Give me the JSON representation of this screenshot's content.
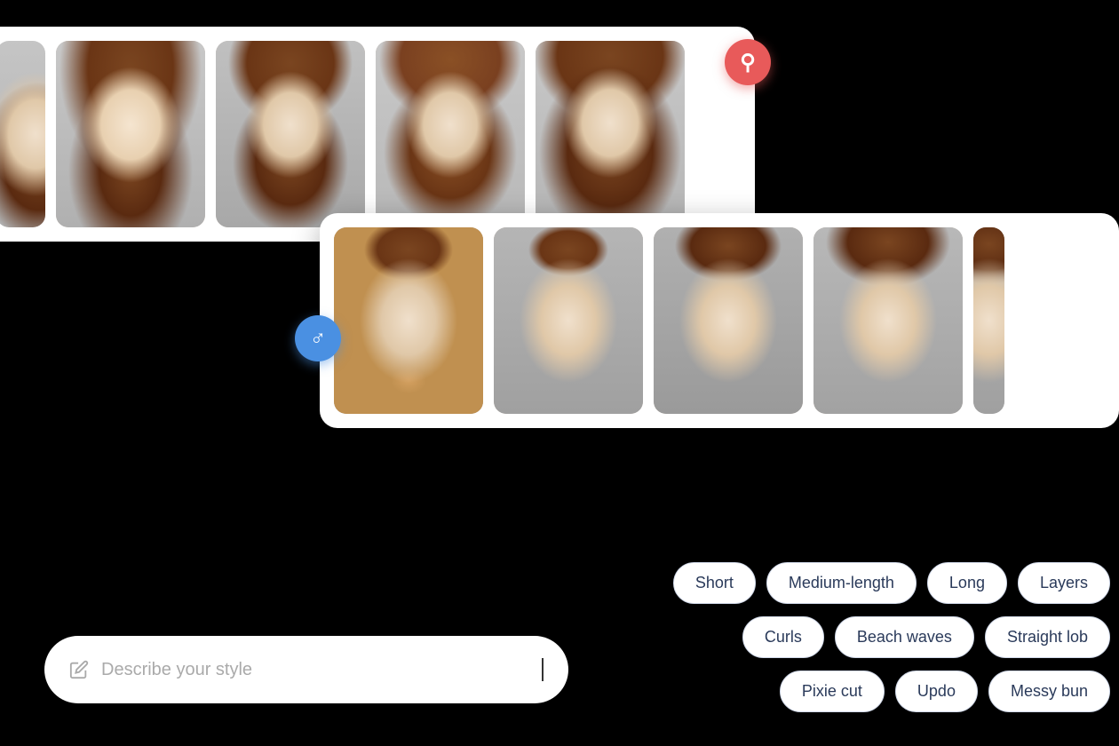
{
  "female_panel": {
    "photos": [
      {
        "id": "f-partial",
        "style": "partial",
        "alt": "Partial female photo"
      },
      {
        "id": "f-long-brown",
        "style": "long-brown",
        "alt": "Long brown hair female"
      },
      {
        "id": "f-medium-bob",
        "style": "medium-bob",
        "alt": "Medium bob female"
      },
      {
        "id": "f-vintage-curl",
        "style": "vintage-curl",
        "alt": "Vintage curls female"
      },
      {
        "id": "f-beach-waves",
        "style": "beach-waves",
        "alt": "Beach waves female"
      }
    ],
    "gender_badge": "♀"
  },
  "male_panel": {
    "photos": [
      {
        "id": "m-style1",
        "style": "style1",
        "alt": "Male hairstyle 1"
      },
      {
        "id": "m-style2",
        "style": "style2",
        "alt": "Male hairstyle 2"
      },
      {
        "id": "m-style3",
        "style": "style3",
        "alt": "Male hairstyle 3"
      },
      {
        "id": "m-style4",
        "style": "style4",
        "alt": "Male hairstyle 4"
      },
      {
        "id": "m-style5",
        "style": "style5",
        "alt": "Male hairstyle 5 partial"
      }
    ],
    "gender_badge": "♂"
  },
  "input": {
    "placeholder": "Describe your style",
    "edit_icon": "✏"
  },
  "style_tags": {
    "row1": [
      "Short",
      "Medium-length",
      "Long",
      "Layers"
    ],
    "row2": [
      "Curls",
      "Beach waves",
      "Straight lob"
    ],
    "row3": [
      "Pixie cut",
      "Updo",
      "Messy bun"
    ]
  }
}
